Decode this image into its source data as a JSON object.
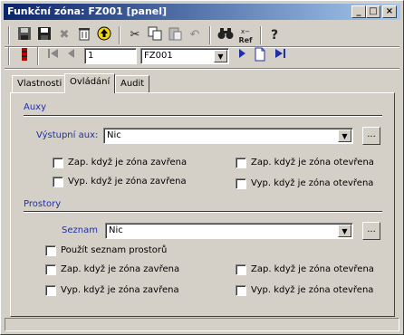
{
  "window": {
    "title": "Funkční zóna: FZ001 [panel]",
    "minimize_glyph": "_",
    "maximize_glyph": "□",
    "close_glyph": "×"
  },
  "toolbar": {
    "icons": {
      "save": "floppy-icon",
      "save_close": "floppy-close-icon",
      "delete": "delete-x-icon",
      "trash": "trash-icon",
      "up": "arrow-up-circle-icon",
      "cut": "scissors-icon",
      "copy": "copy-icon",
      "paste": "paste-icon",
      "undo": "undo-icon",
      "find": "binoculars-icon",
      "refresh": "ref-icon",
      "help": "question-icon"
    },
    "ref_text": "Ref",
    "help_glyph": "?",
    "record_number": "1",
    "record_select": "FZ001"
  },
  "tabs": [
    {
      "label": "Vlastnosti",
      "active": false
    },
    {
      "label": "Ovládání",
      "active": true
    },
    {
      "label": "Audit",
      "active": false
    }
  ],
  "auxy": {
    "section_title": "Auxy",
    "output_label": "Výstupní aux:",
    "output_value": "Nic",
    "browse_label": "...",
    "checks": [
      {
        "label": "Zap. když je zóna zavřena",
        "checked": false
      },
      {
        "label": "Zap. když je zóna otevřena",
        "checked": false
      },
      {
        "label": "Vyp. když je zóna zavřena",
        "checked": false
      },
      {
        "label": "Vyp. když je zóna otevřena",
        "checked": false
      }
    ]
  },
  "prostory": {
    "section_title": "Prostory",
    "list_label": "Seznam",
    "list_value": "Nic",
    "browse_label": "...",
    "use_list_label": "Použít seznam prostorů",
    "checks": [
      {
        "label": "Zap. když je zóna zavřena",
        "checked": false
      },
      {
        "label": "Zap. když je zóna otevřena",
        "checked": false
      },
      {
        "label": "Vyp. když je zóna zavřena",
        "checked": false
      },
      {
        "label": "Vyp. když je zóna otevřena",
        "checked": false
      }
    ]
  },
  "colors": {
    "title_start": "#0a246a",
    "title_end": "#a6caf0",
    "section_blue": "#1f2fa8",
    "face": "#d4d0c8"
  }
}
